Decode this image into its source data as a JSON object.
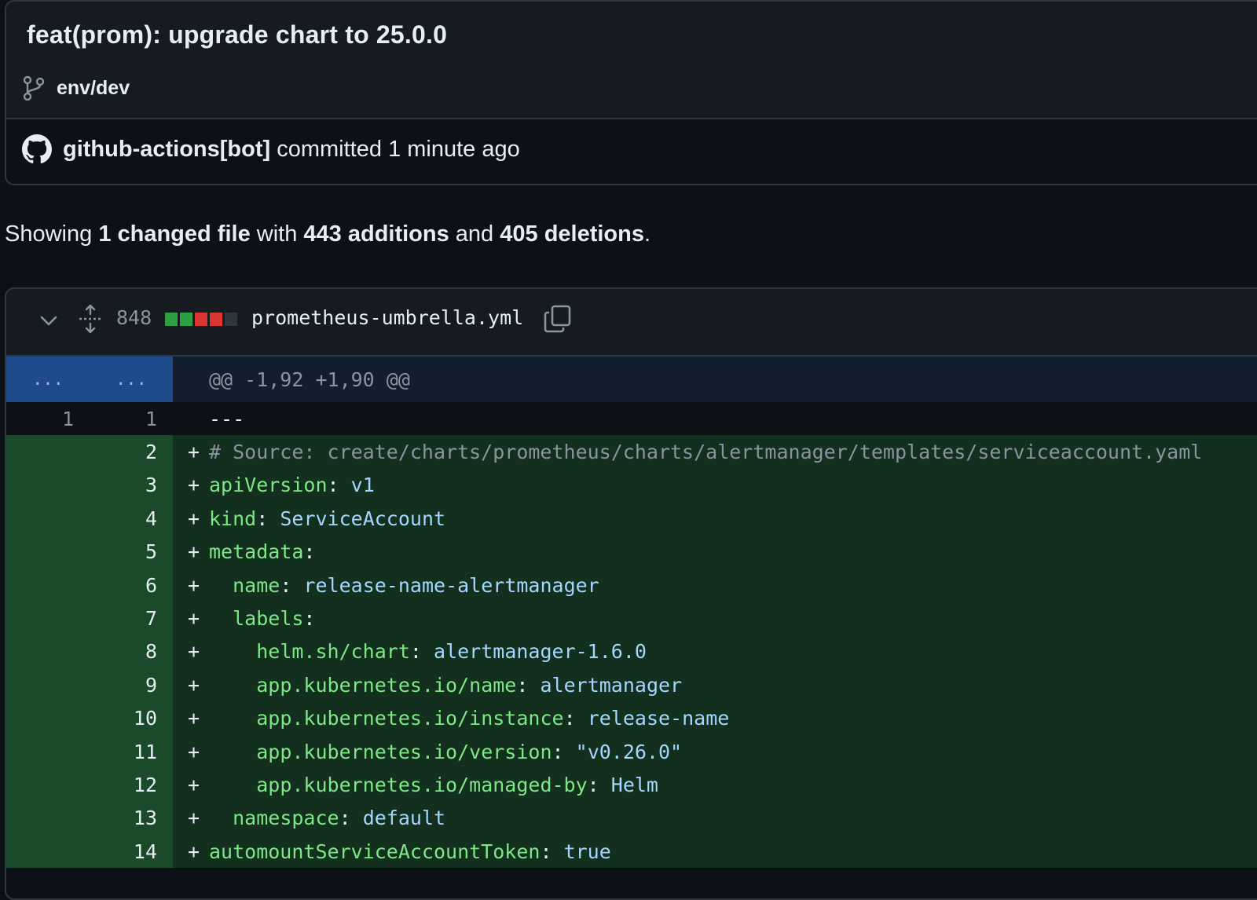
{
  "commit": {
    "title": "feat(prom): upgrade chart to 25.0.0",
    "branch": "env/dev",
    "author": "github-actions[bot]",
    "action": "committed",
    "time": "1 minute ago"
  },
  "summary": {
    "prefix": "Showing",
    "files": "1 changed file",
    "with": "with",
    "additions": "443 additions",
    "and": "and",
    "deletions": "405 deletions",
    "end": "."
  },
  "file": {
    "change_count": "848",
    "name": "prometheus-umbrella.yml",
    "diffstat_colors": [
      "#2ea043",
      "#2ea043",
      "#da3633",
      "#da3633",
      "#30363d"
    ]
  },
  "diff": {
    "hunk": {
      "old_marker": "...",
      "new_marker": "...",
      "header": "@@ -1,92 +1,90 @@"
    },
    "context_line": {
      "old": "1",
      "new": "1",
      "text": "---"
    },
    "added_lines": [
      {
        "num": "2",
        "indent": "",
        "comment": "# Source: create/charts/prometheus/charts/alertmanager/templates/serviceaccount.yaml"
      },
      {
        "num": "3",
        "indent": "",
        "key": "apiVersion",
        "value": "v1"
      },
      {
        "num": "4",
        "indent": "",
        "key": "kind",
        "value": "ServiceAccount"
      },
      {
        "num": "5",
        "indent": "",
        "key": "metadata",
        "value": ""
      },
      {
        "num": "6",
        "indent": "  ",
        "key": "name",
        "value": "release-name-alertmanager"
      },
      {
        "num": "7",
        "indent": "  ",
        "key": "labels",
        "value": ""
      },
      {
        "num": "8",
        "indent": "    ",
        "key": "helm.sh/chart",
        "value": "alertmanager-1.6.0"
      },
      {
        "num": "9",
        "indent": "    ",
        "key": "app.kubernetes.io/name",
        "value": "alertmanager"
      },
      {
        "num": "10",
        "indent": "    ",
        "key": "app.kubernetes.io/instance",
        "value": "release-name"
      },
      {
        "num": "11",
        "indent": "    ",
        "key": "app.kubernetes.io/version",
        "value": "\"v0.26.0\""
      },
      {
        "num": "12",
        "indent": "    ",
        "key": "app.kubernetes.io/managed-by",
        "value": "Helm"
      },
      {
        "num": "13",
        "indent": "  ",
        "key": "namespace",
        "value": "default"
      },
      {
        "num": "14",
        "indent": "",
        "key": "automountServiceAccountToken",
        "value": "true"
      }
    ]
  }
}
